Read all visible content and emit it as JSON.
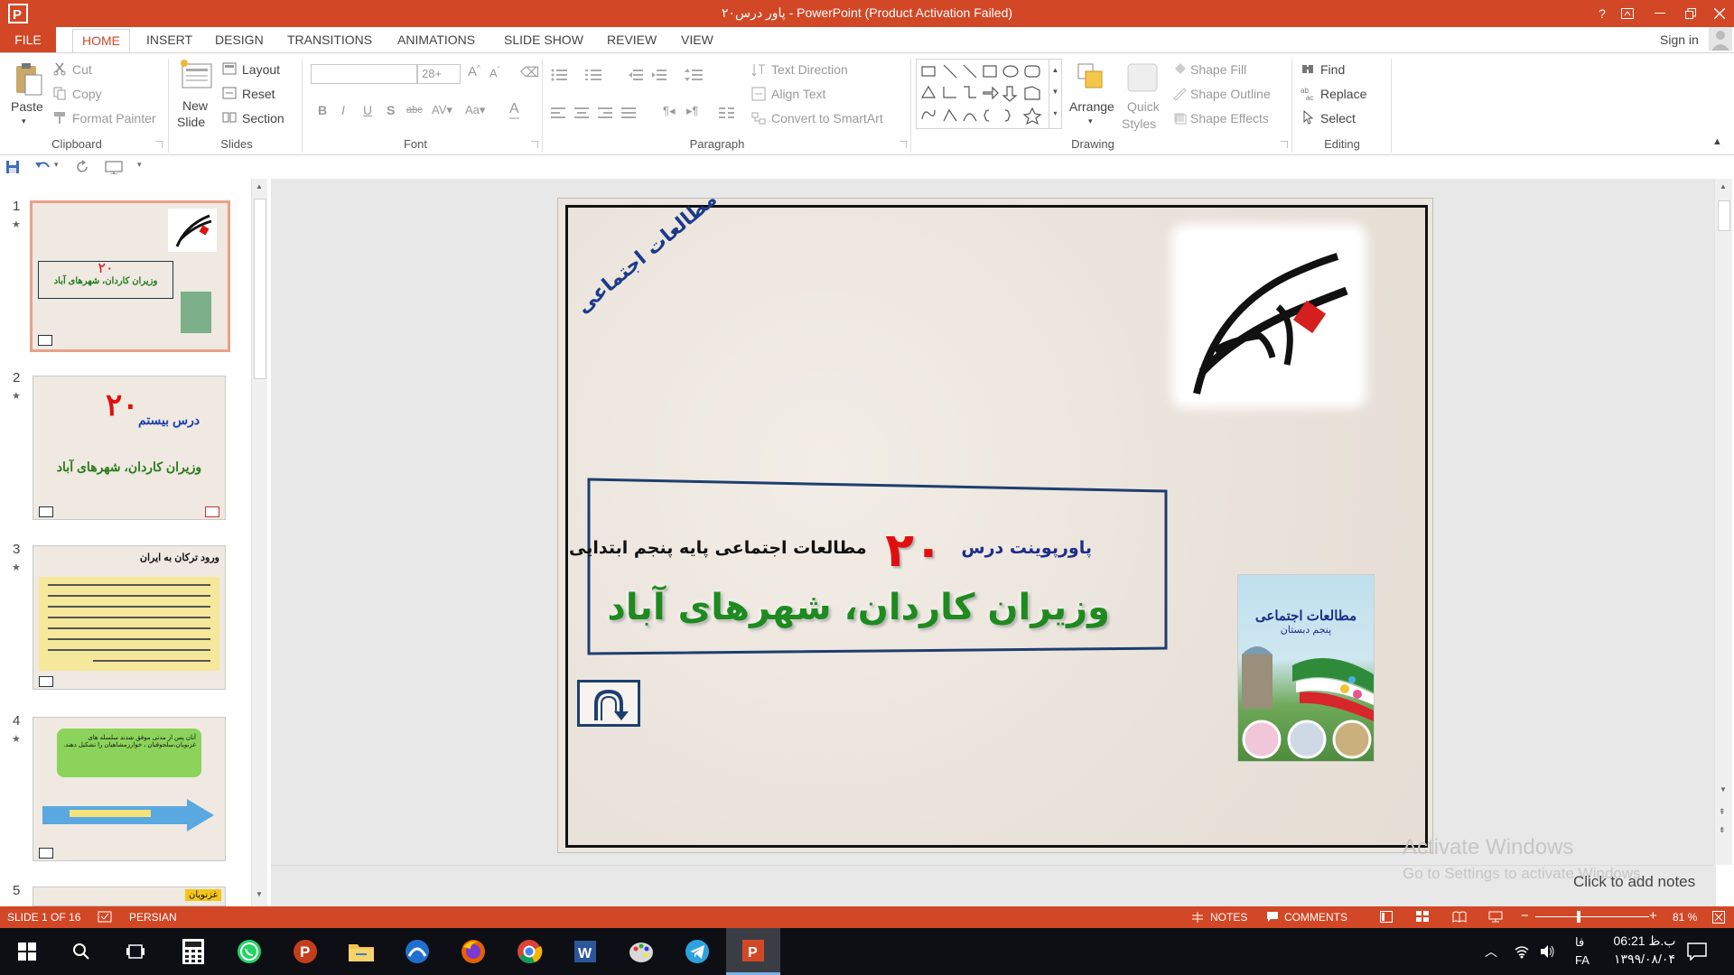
{
  "window": {
    "title": "پاور درس۲۰  -  PowerPoint (Product Activation Failed)",
    "help": "?",
    "sign_in": "Sign in"
  },
  "tabs": [
    "FILE",
    "HOME",
    "INSERT",
    "DESIGN",
    "TRANSITIONS",
    "ANIMATIONS",
    "SLIDE SHOW",
    "REVIEW",
    "VIEW"
  ],
  "ribbon": {
    "clipboard": {
      "paste": "Paste",
      "cut": "Cut",
      "copy": "Copy",
      "format_painter": "Format Painter",
      "label": "Clipboard"
    },
    "slides": {
      "new_slide_1": "New",
      "new_slide_2": "Slide",
      "layout": "Layout",
      "reset": "Reset",
      "section": "Section",
      "label": "Slides"
    },
    "font": {
      "font_size": "28+",
      "label": "Font"
    },
    "paragraph": {
      "text_direction": "Text Direction",
      "align_text": "Align Text",
      "convert_smartart": "Convert to SmartArt",
      "label": "Paragraph"
    },
    "drawing": {
      "arrange": "Arrange",
      "quick_styles_1": "Quick",
      "quick_styles_2": "Styles",
      "shape_fill": "Shape Fill",
      "shape_outline": "Shape Outline",
      "shape_effects": "Shape Effects",
      "label": "Drawing"
    },
    "editing": {
      "find": "Find",
      "replace": "Replace",
      "select": "Select",
      "label": "Editing"
    }
  },
  "thumbnails": [
    {
      "num": "1",
      "title": "",
      "subtitle": "وزیران کاردان، شهرهای آباد"
    },
    {
      "num": "2",
      "title": "درس بیستم",
      "subtitle": "وزیران کاردان، شهرهای آباد",
      "big": "۲۰"
    },
    {
      "num": "3",
      "title": "ورود ترکان به ایران"
    },
    {
      "num": "4",
      "title": "آنان پس از مدتی موفق شدند سلسله های غزنویان،سلجوقیان ، خوارزمشاهیان را تشکیل دهند."
    },
    {
      "num": "5",
      "title": "غزنویان"
    }
  ],
  "slide": {
    "corner_text": "مطالعات اجتماعی",
    "line1_prefix": "پاورپوینت درس",
    "number": "۲۰",
    "line1_suffix": "مطالعات اجتماعی پایه پنجم ابتدایی",
    "main_title": "وزیران کاردان، شهرهای آباد",
    "book_title": "مطالعات اجتماعی",
    "book_subtitle": "پنجم دبستان"
  },
  "notes_placeholder": "Click to add notes",
  "watermark": {
    "line1": "Activate Windows",
    "line2": "Go to Settings to activate Windows."
  },
  "status": {
    "slide_of": "SLIDE 1 OF 16",
    "language": "PERSIAN",
    "notes": "NOTES",
    "comments": "COMMENTS",
    "zoom": "81 %"
  },
  "taskbar": {
    "time": "06:21 ب.ظ",
    "date": "۱۳۹۹/۰۸/۰۴",
    "lang1": "فا",
    "lang2": "FA"
  },
  "colors": {
    "accent": "#d24726",
    "taskbar": "#0d0f14",
    "slide_title_green": "#1f8a1f",
    "slide_number_red": "#e01010"
  }
}
